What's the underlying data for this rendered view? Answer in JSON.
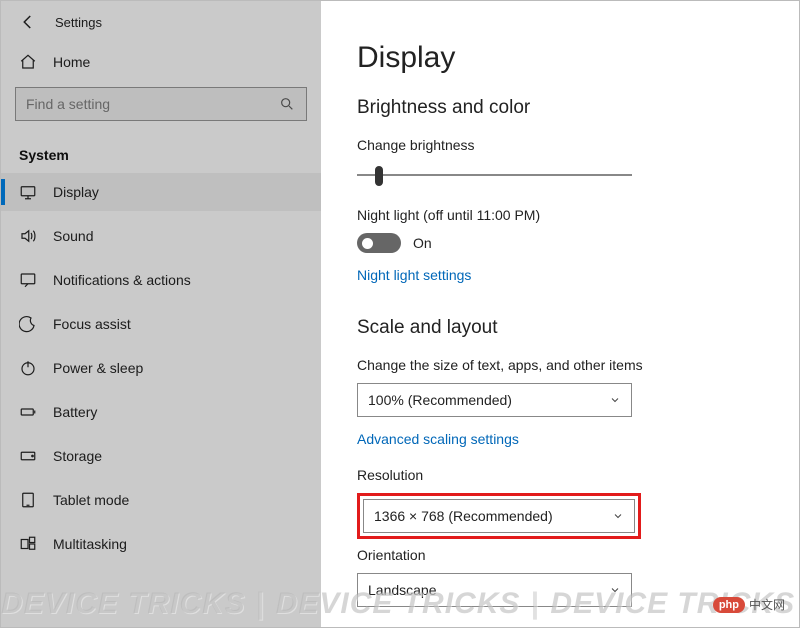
{
  "window": {
    "title": "Settings"
  },
  "sidebar": {
    "home": "Home",
    "search_placeholder": "Find a setting",
    "section": "System",
    "items": [
      {
        "label": "Display",
        "icon": "display-icon",
        "active": true
      },
      {
        "label": "Sound",
        "icon": "sound-icon"
      },
      {
        "label": "Notifications & actions",
        "icon": "notifications-icon"
      },
      {
        "label": "Focus assist",
        "icon": "focus-icon"
      },
      {
        "label": "Power & sleep",
        "icon": "power-icon"
      },
      {
        "label": "Battery",
        "icon": "battery-icon"
      },
      {
        "label": "Storage",
        "icon": "storage-icon"
      },
      {
        "label": "Tablet mode",
        "icon": "tablet-icon"
      },
      {
        "label": "Multitasking",
        "icon": "multitasking-icon"
      }
    ]
  },
  "main": {
    "heading": "Display",
    "brightness_section": "Brightness and color",
    "brightness_label": "Change brightness",
    "night_light_label": "Night light (off until 11:00 PM)",
    "night_light_state": "On",
    "night_light_link": "Night light settings",
    "scale_section": "Scale and layout",
    "scale_label": "Change the size of text, apps, and other items",
    "scale_value": "100% (Recommended)",
    "advanced_link": "Advanced scaling settings",
    "resolution_label": "Resolution",
    "resolution_value": "1366 × 768 (Recommended)",
    "orientation_label": "Orientation",
    "orientation_value": "Landscape"
  },
  "watermark": {
    "text": "DEVICE TRICKS",
    "badge": "php",
    "badge_cn": "中文网"
  }
}
